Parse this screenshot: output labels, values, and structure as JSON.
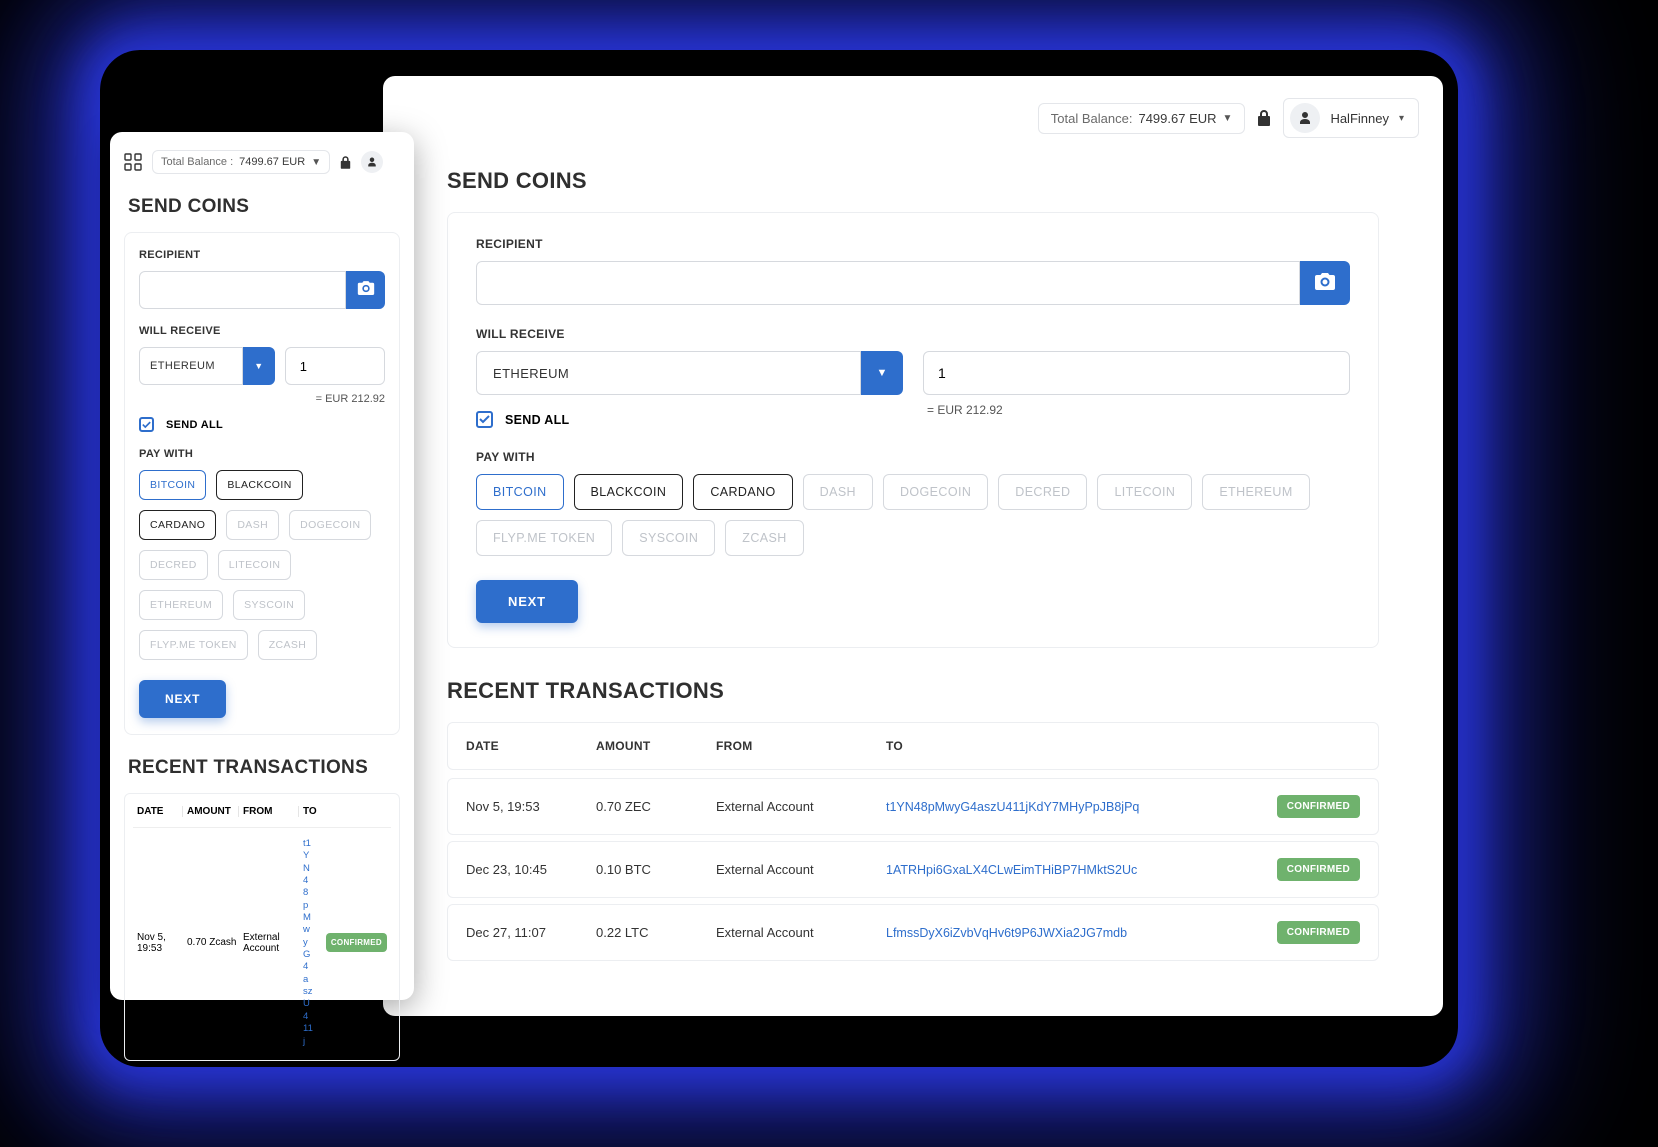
{
  "header": {
    "balance_label": "Total Balance :",
    "balance_label_d": "Total Balance:",
    "balance_value": "7499.67 EUR",
    "username": "HalFinney"
  },
  "send": {
    "title": "SEND COINS",
    "recipient_label": "RECIPIENT",
    "will_receive_label": "WILL RECEIVE",
    "currency_selected": "ETHEREUM",
    "amount_value": "1",
    "eq_value": "= EUR 212.92",
    "send_all_label": "SEND ALL",
    "pay_with_label": "PAY WITH",
    "next_label": "NEXT",
    "coins_desktop": [
      {
        "label": "BITCOIN",
        "state": "sel"
      },
      {
        "label": "BLACKCOIN",
        "state": "strong"
      },
      {
        "label": "CARDANO",
        "state": "strong"
      },
      {
        "label": "DASH",
        "state": ""
      },
      {
        "label": "DOGECOIN",
        "state": ""
      },
      {
        "label": "DECRED",
        "state": ""
      },
      {
        "label": "LITECOIN",
        "state": ""
      },
      {
        "label": "ETHEREUM",
        "state": ""
      },
      {
        "label": "FLYP.ME TOKEN",
        "state": ""
      },
      {
        "label": "SYSCOIN",
        "state": ""
      },
      {
        "label": "ZCASH",
        "state": ""
      }
    ],
    "coins_mobile": [
      {
        "label": "BITCOIN",
        "state": "sel"
      },
      {
        "label": "BLACKCOIN",
        "state": "strong"
      },
      {
        "label": "CARDANO",
        "state": "strong"
      },
      {
        "label": "DASH",
        "state": ""
      },
      {
        "label": "DOGECOIN",
        "state": ""
      },
      {
        "label": "DECRED",
        "state": ""
      },
      {
        "label": "LITECOIN",
        "state": ""
      },
      {
        "label": "ETHEREUM",
        "state": ""
      },
      {
        "label": "SYSCOIN",
        "state": ""
      },
      {
        "label": "FLYP.ME TOKEN",
        "state": ""
      },
      {
        "label": "ZCASH",
        "state": ""
      }
    ]
  },
  "tx": {
    "title": "RECENT TRANSACTIONS",
    "headers": {
      "date": "DATE",
      "amount": "AMOUNT",
      "from": "FROM",
      "to": "TO"
    },
    "rows_desktop": [
      {
        "date": "Nov 5, 19:53",
        "amount": "0.70 ZEC",
        "from": "External Account",
        "to": "t1YN48pMwyG4aszU411jKdY7MHyPpJB8jPq",
        "status": "CONFIRMED"
      },
      {
        "date": "Dec 23, 10:45",
        "amount": "0.10 BTC",
        "from": "External Account",
        "to": "1ATRHpi6GxaLX4CLwEimTHiBP7HMktS2Uc",
        "status": "CONFIRMED"
      },
      {
        "date": "Dec 27, 11:07",
        "amount": "0.22 LTC",
        "from": "External Account",
        "to": "LfmssDyX6iZvbVqHv6t9P6JWXia2JG7mdb",
        "status": "CONFIRMED"
      }
    ],
    "row_mobile": {
      "date": "Nov 5, 19:53",
      "amount": "0.70 Zcash",
      "from": "External Account",
      "to": "t1YN48pMwyG4aszU411j",
      "status": "CONFIRMED"
    }
  }
}
